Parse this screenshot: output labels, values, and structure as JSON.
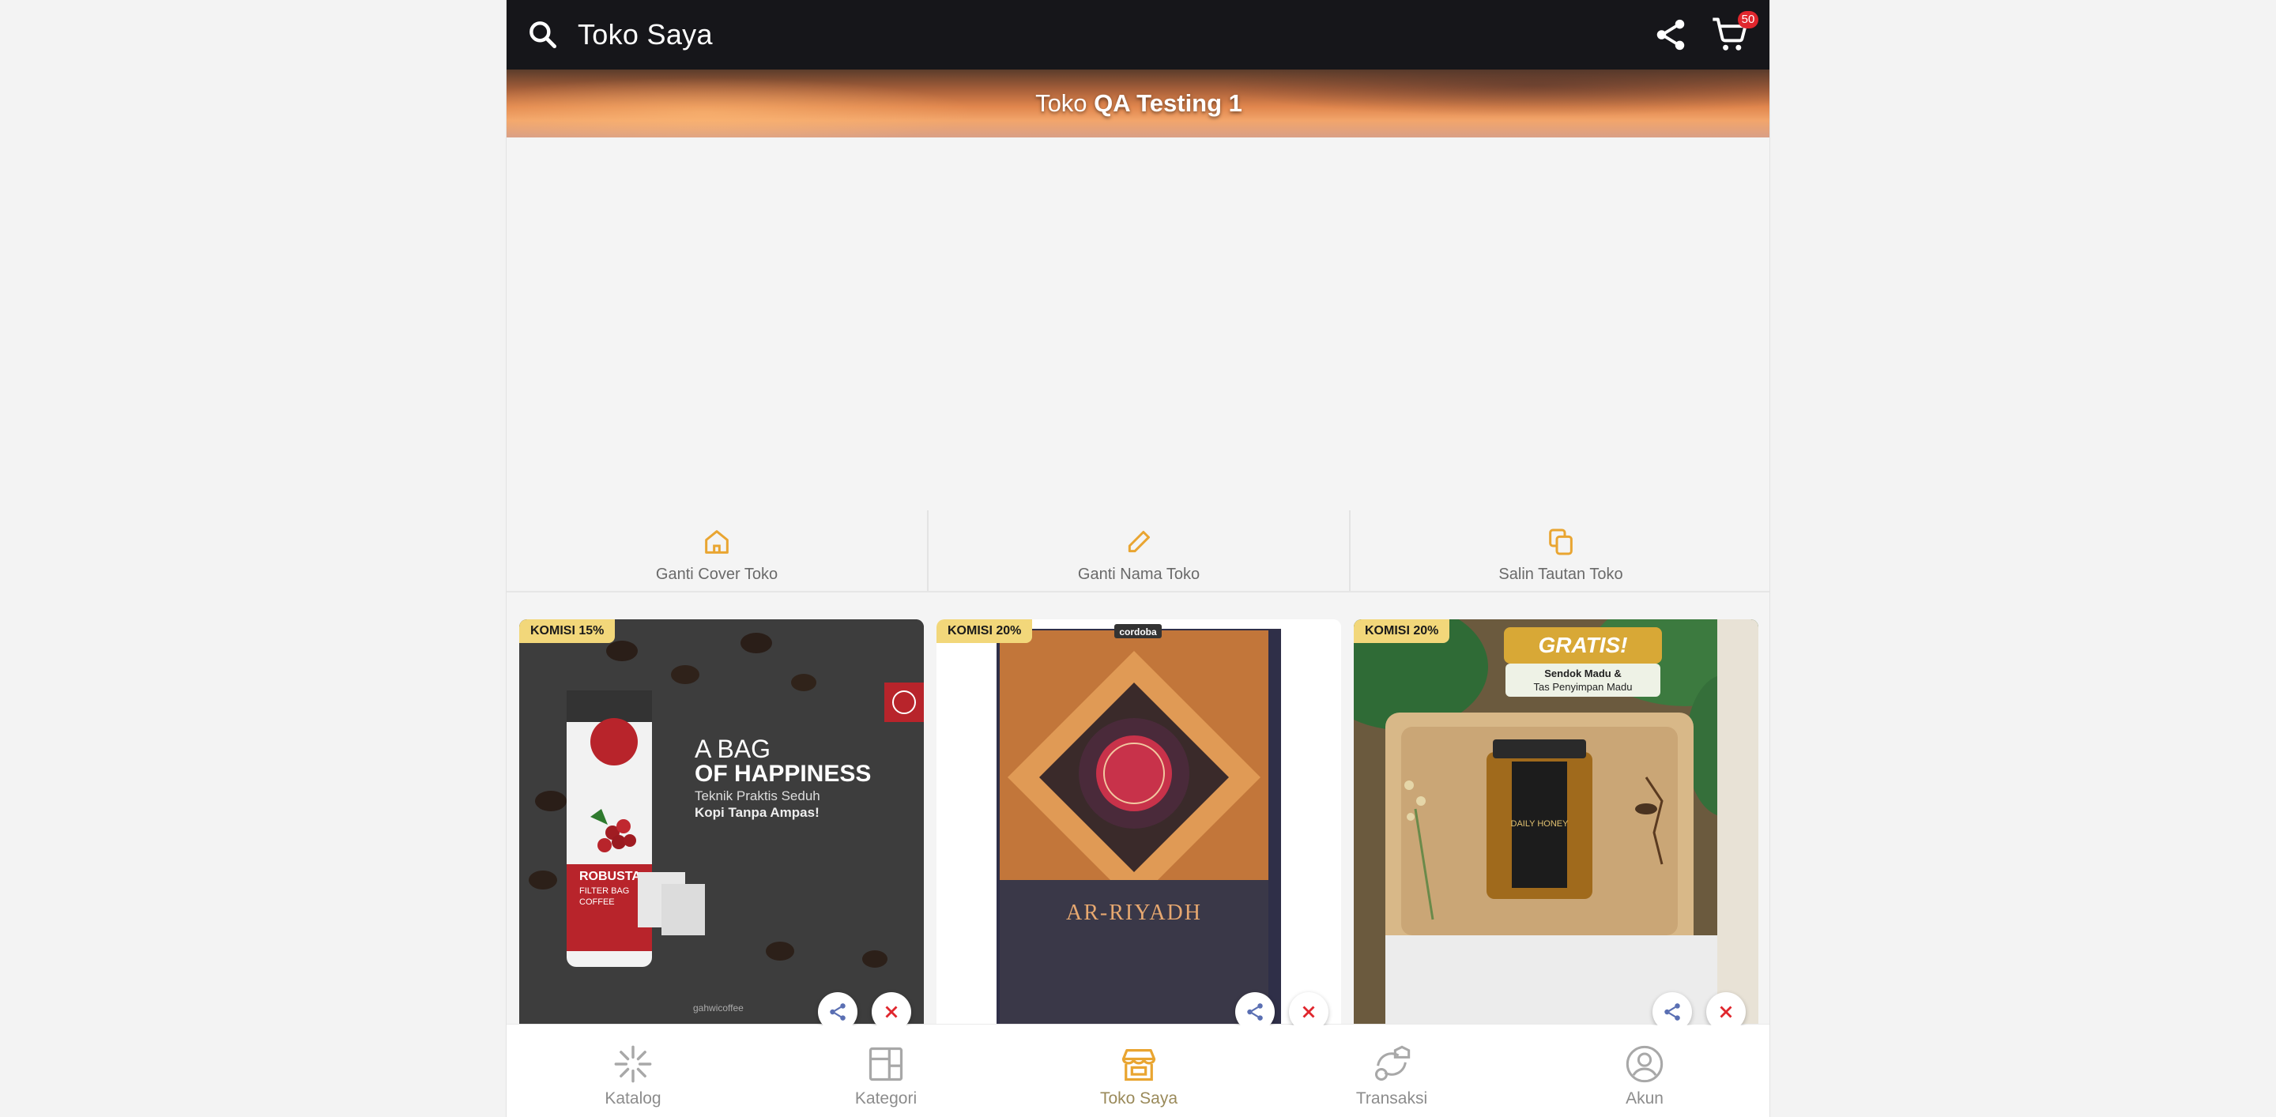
{
  "header": {
    "title": "Toko Saya",
    "cart_count": "50"
  },
  "store": {
    "prefix": "Toko",
    "name": "QA Testing 1"
  },
  "actions": [
    {
      "label": "Ganti Cover Toko"
    },
    {
      "label": "Ganti Nama Toko"
    },
    {
      "label": "Salin Tautan Toko"
    }
  ],
  "products": [
    {
      "commission": "KOMISI 15%",
      "art": {
        "line1": "A BAG",
        "line2": "OF HAPPINESS",
        "line3": "Teknik Praktis Seduh",
        "line4": "Kopi Tanpa Ampas!",
        "pack1": "ROBUSTA",
        "pack2": "FILTER BAG",
        "pack3": "COFFEE",
        "brand": "gahwicoffee"
      }
    },
    {
      "commission": "KOMISI 20%",
      "art": {
        "publisher": "cordoba",
        "title": "AR-RIYADH"
      }
    },
    {
      "commission": "KOMISI 20%",
      "art": {
        "promo": "GRATIS!",
        "promo1": "Sendok Madu &",
        "promo2": "Tas Penyimpan Madu",
        "jar": "DAILY HONEY"
      }
    }
  ],
  "nav": [
    {
      "label": "Katalog"
    },
    {
      "label": "Kategori"
    },
    {
      "label": "Toko Saya"
    },
    {
      "label": "Transaksi"
    },
    {
      "label": "Akun"
    }
  ],
  "colors": {
    "topbar": "#16161a",
    "accent": "#e9a531",
    "commission": "#f2d77a",
    "badge": "#e0262d",
    "remove": "#e0262d",
    "share": "#5a6fb3"
  }
}
